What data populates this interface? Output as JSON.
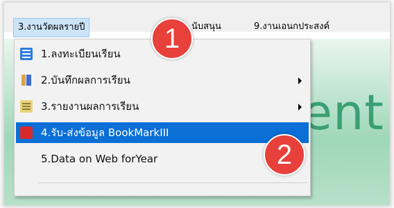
{
  "menubar": {
    "active_menu": "3.งานวัดผลรายปี",
    "partial_menu": "นับสนุน",
    "goal_menu": "9.งานเอนกประสงค์"
  },
  "background": {
    "text": "ent"
  },
  "dropdown": {
    "items": [
      {
        "label": "1.ลงทะเบียนเรียน",
        "icon": "register-list-icon",
        "has_submenu": false
      },
      {
        "label": "2.บันทึกผลการเรียน",
        "icon": "notes-icon",
        "has_submenu": true
      },
      {
        "label": "3.รายงานผลการเรียน",
        "icon": "report-icon",
        "has_submenu": true
      },
      {
        "label": "4.รับ-ส่งข้อมูล BookMarkIII",
        "icon": "book-icon",
        "has_submenu": false,
        "highlighted": true
      },
      {
        "label": "5.Data on Web forYear",
        "icon": "",
        "has_submenu": false
      }
    ]
  },
  "annotations": {
    "badge_1": "1",
    "badge_2": "2"
  },
  "colors": {
    "highlight": "#0a6fd6",
    "badge": "#e8403a",
    "menu_active": "#cce4f7"
  }
}
